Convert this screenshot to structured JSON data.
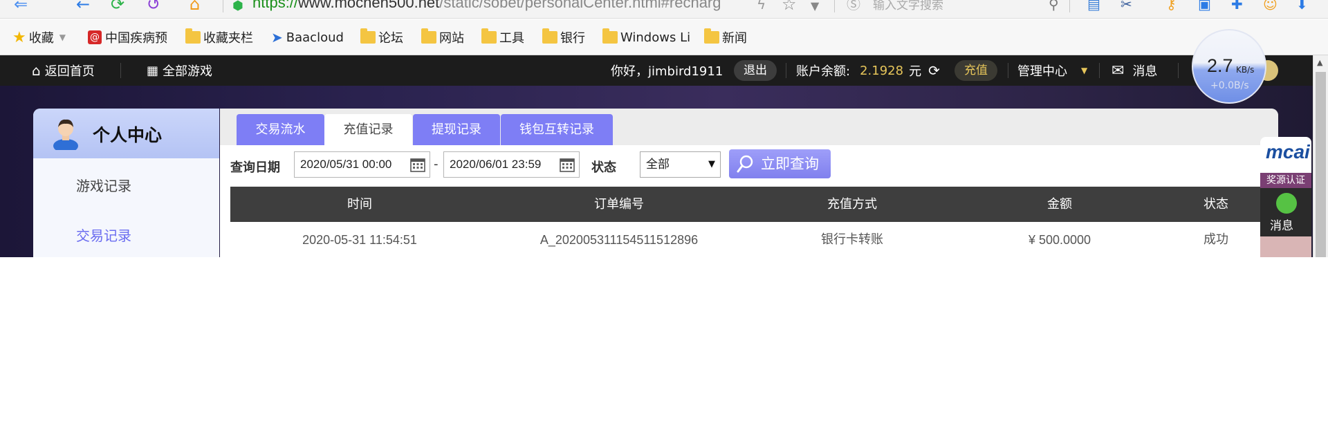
{
  "browser": {
    "url_scheme": "https://",
    "url_host": "www.mochen500.net",
    "url_path": "/static/sobet/personalCenter.html#recharg",
    "search_placeholder": "输入文字搜索"
  },
  "bookmarks": {
    "favorites": "收藏",
    "items": [
      "中国疾病预",
      "收藏夹栏",
      "Baacloud",
      "论坛",
      "网站",
      "工具",
      "银行",
      "Windows Li",
      "新闻"
    ]
  },
  "nav": {
    "home": "返回首页",
    "all_games": "全部游戏",
    "greeting": "你好，jimbird1911",
    "logout": "退出",
    "balance_label": "账户余额:",
    "balance_value": "2.1928",
    "currency_unit": "元",
    "recharge": "充值",
    "admin_center": "管理中心",
    "messages": "消息"
  },
  "speed_widget": {
    "value": "2.7",
    "unit": "KB/s",
    "delta": "+0.0B/s"
  },
  "side_panel": {
    "title": "个人中心",
    "items": [
      "游戏记录",
      "交易记录"
    ],
    "active_index": 1
  },
  "tabs": [
    "交易流水",
    "充值记录",
    "提现记录",
    "钱包互转记录"
  ],
  "active_tab": 1,
  "filter": {
    "date_label": "查询日期",
    "date_from": "2020/05/31 00:00",
    "date_sep": "-",
    "date_to": "2020/06/01 23:59",
    "status_label": "状态",
    "status_value": "全部",
    "query_button": "立即查询"
  },
  "table": {
    "columns": [
      "时间",
      "订单编号",
      "充值方式",
      "金额",
      "状态"
    ],
    "rows": [
      [
        "2020-05-31 11:54:51",
        "A_20200531115451151289​6",
        "银行卡转账",
        "¥ 500.0000",
        "成功"
      ]
    ]
  },
  "right_widgets": {
    "brand": "mcai",
    "certification": "奖源认证",
    "message": "消息"
  },
  "colors": {
    "accent_purple": "#7e7ef5",
    "nav_dark": "#1c1c1c",
    "gold": "#e6c55a",
    "table_header": "#3e3e3e"
  }
}
